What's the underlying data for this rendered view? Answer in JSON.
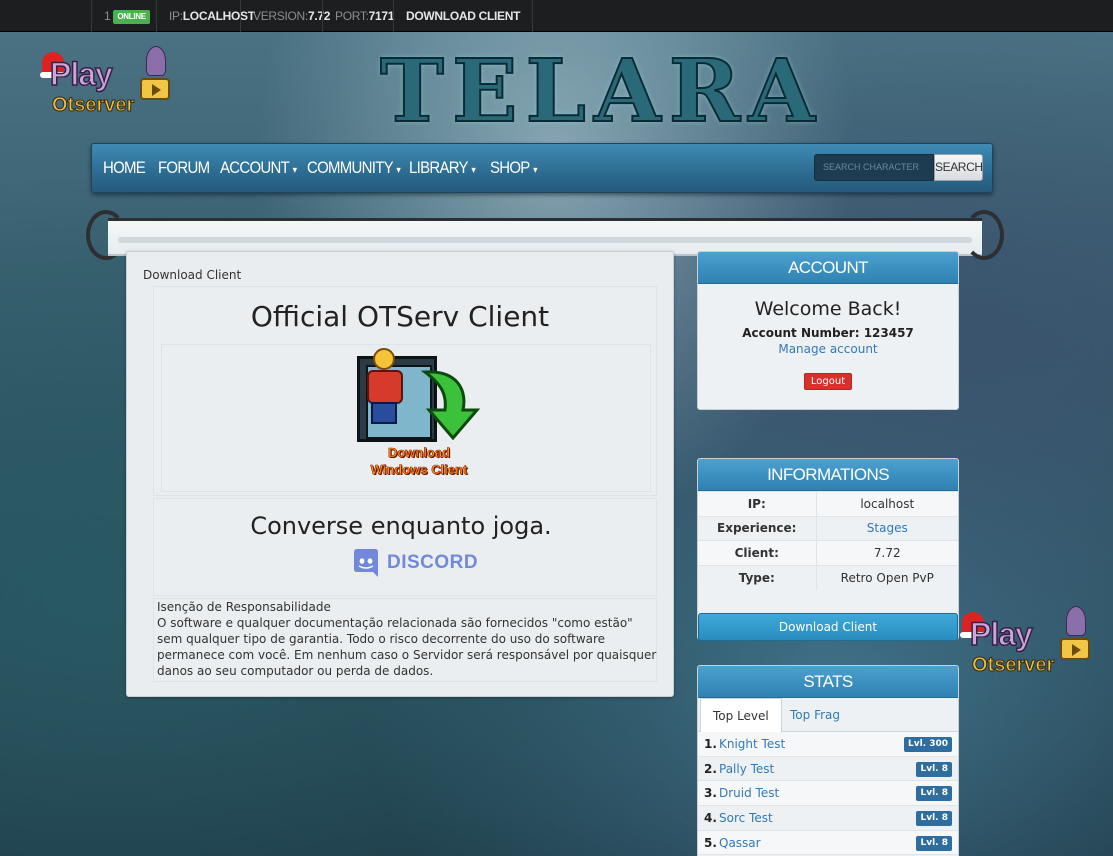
{
  "topbar": {
    "online_count": "1",
    "online_label": "ONLINE",
    "ip_label": "IP:",
    "ip_value": "LOCALHOST",
    "version_label": "VERSION:",
    "version_value": "7.72",
    "port_label": "PORT:",
    "port_value": "7171",
    "download_label": "DOWNLOAD CLIENT"
  },
  "logos": {
    "play_word": "Play",
    "otserver_word": "Otserver",
    "site_logo": "TELARA"
  },
  "nav": {
    "items": [
      {
        "label": "HOME",
        "dropdown": false
      },
      {
        "label": "FORUM",
        "dropdown": false
      },
      {
        "label": "ACCOUNT",
        "dropdown": true
      },
      {
        "label": "COMMUNITY",
        "dropdown": true
      },
      {
        "label": "LIBRARY",
        "dropdown": true
      },
      {
        "label": "SHOP",
        "dropdown": true
      }
    ],
    "caret": "▾",
    "search_placeholder": "SEARCH CHARACTER",
    "search_button": "SEARCH"
  },
  "main": {
    "breadcrumb": "Download Client",
    "official_title": "Official OTServ Client",
    "download_line1": "Download",
    "download_line2": "Windows Client",
    "converse_title": "Converse enquanto joga.",
    "discord_word": "DISCORD",
    "disclaimer_title": "Isenção de Responsabilidade",
    "disclaimer_text": "O software e qualquer documentação relacionada são fornecidos \"como estão\" sem qualquer tipo de garantia. Todo o risco decorrente do uso do software permanece com você. Em nenhum caso o Servidor será responsável por quaisquer danos ao seu computador ou perda de dados."
  },
  "account": {
    "header": "ACCOUNT",
    "welcome": "Welcome Back!",
    "account_number_label": "Account Number:",
    "account_number": "123457",
    "manage_link": "Manage account",
    "logout": "Logout"
  },
  "informations": {
    "header": "INFORMATIONS",
    "rows": [
      {
        "key": "IP:",
        "value": "localhost",
        "link": false
      },
      {
        "key": "Experience:",
        "value": "Stages",
        "link": true
      },
      {
        "key": "Client:",
        "value": "7.72",
        "link": false
      },
      {
        "key": "Type:",
        "value": "Retro Open PvP",
        "link": false
      }
    ],
    "download_button": "Download Client"
  },
  "stats": {
    "header": "STATS",
    "tabs": [
      "Top Level",
      "Top Frag"
    ],
    "active_tab": "Top Level",
    "players": [
      {
        "rank": "1.",
        "name": "Knight Test",
        "level": "Lvl. 300"
      },
      {
        "rank": "2.",
        "name": "Pally Test",
        "level": "Lvl. 8"
      },
      {
        "rank": "3.",
        "name": "Druid Test",
        "level": "Lvl. 8"
      },
      {
        "rank": "4.",
        "name": "Sorc Test",
        "level": "Lvl. 8"
      },
      {
        "rank": "5.",
        "name": "Qassar",
        "level": "Lvl. 8"
      }
    ]
  },
  "colors": {
    "nav_blue": "#2e6e94",
    "header_blue": "#3a93c5",
    "online_green": "#4caf50",
    "logout_red": "#d9302c",
    "link_blue": "#337ab7",
    "discord": "#7289da"
  }
}
